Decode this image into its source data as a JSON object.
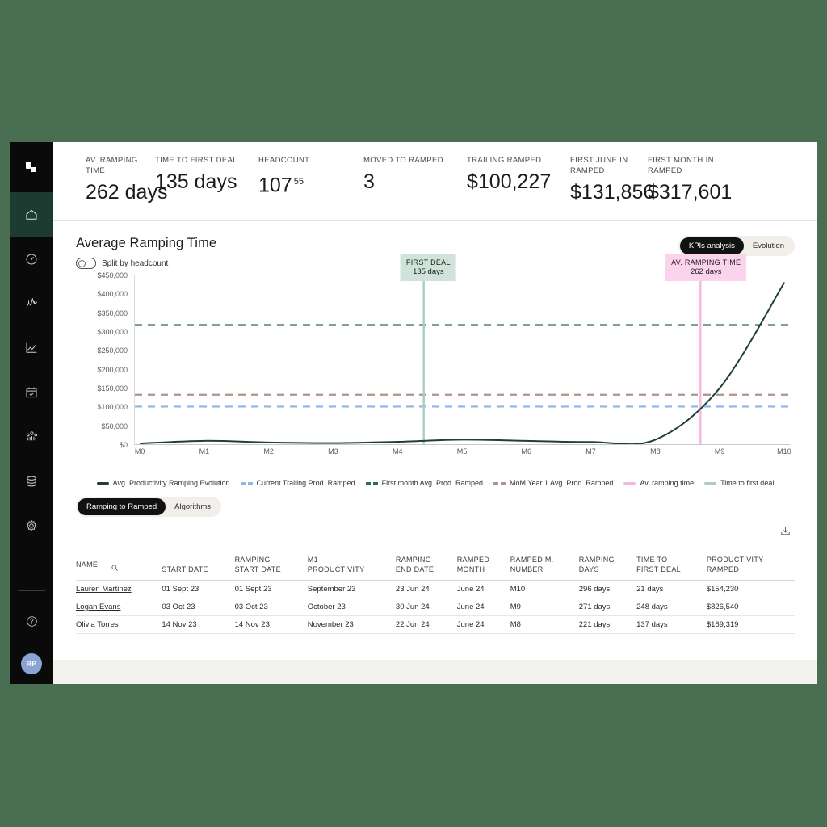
{
  "theme": {
    "page_bg": "#4a6e52",
    "sidebar_bg": "#0a0a0a",
    "active_nav_bg": "#1d3b31",
    "accent_dark": "#111111",
    "seg_track": "#f2eeea",
    "series_main": "#1f4038",
    "series_trailing": "#8ab6e8",
    "series_first_month": "#2f6b54",
    "series_mom": "#b09389",
    "series_ramping_time": "#f9b6dd",
    "series_time_first_deal": "#a8cfc0",
    "avatar_bg": "#8aa4d6"
  },
  "sidebar": {
    "logo": "brand-logo",
    "items": [
      {
        "name": "home",
        "icon": "home-icon",
        "active": true
      },
      {
        "name": "speedometer",
        "icon": "gauge-icon",
        "active": false
      },
      {
        "name": "activity",
        "icon": "pulse-bars-icon",
        "active": false
      },
      {
        "name": "analytics",
        "icon": "line-chart-icon",
        "active": false
      },
      {
        "name": "planning",
        "icon": "calendar-check-icon",
        "active": false
      },
      {
        "name": "team",
        "icon": "people-icon",
        "active": false
      },
      {
        "name": "data",
        "icon": "database-icon",
        "active": false
      },
      {
        "name": "settings",
        "icon": "gear-icon",
        "active": false
      }
    ],
    "help": {
      "name": "help",
      "icon": "question-circle-icon"
    },
    "avatar_initials": "RP"
  },
  "kpis": [
    {
      "label": "AV. RAMPING TIME",
      "value": "262 days",
      "sup": ""
    },
    {
      "label": "TIME TO FIRST DEAL",
      "value": "135 days",
      "sup": ""
    },
    {
      "label": "HEADCOUNT",
      "value": "107",
      "sup": "55"
    },
    {
      "label": "MOVED TO RAMPED",
      "value": "3",
      "sup": ""
    },
    {
      "label": "TRAILING RAMPED",
      "value": "$100,227",
      "sup": ""
    },
    {
      "label": "FIRST JUNE IN\nRAMPED",
      "value": "$131,856",
      "sup": ""
    },
    {
      "label": "FIRST MONTH IN\nRAMPED",
      "value": "$317,601",
      "sup": ""
    }
  ],
  "chart_section": {
    "title": "Average Ramping Time",
    "split_toggle_label": "Split by headcount",
    "split_toggle_on": false,
    "view_tabs": [
      {
        "label": "KPIs analysis",
        "active": true
      },
      {
        "label": "Evolution",
        "active": false
      }
    ]
  },
  "chart_data": {
    "type": "line",
    "title": "Average Ramping Time",
    "xlabel": "",
    "ylabel": "",
    "grid": false,
    "legend_position": "bottom",
    "categories": [
      "M0",
      "M1",
      "M2",
      "M3",
      "M4",
      "M5",
      "M6",
      "M7",
      "M8",
      "M9",
      "M10"
    ],
    "ylim": [
      0,
      450000
    ],
    "yticks": [
      0,
      50000,
      100000,
      150000,
      200000,
      250000,
      300000,
      350000,
      400000,
      450000
    ],
    "ytick_labels": [
      "$0",
      "$50,000",
      "$100,000",
      "$150,000",
      "$200,000",
      "$250,000",
      "$300,000",
      "$350,000",
      "$400,000",
      "$450,000"
    ],
    "series": [
      {
        "name": "Avg. Productivity Ramping Evolution",
        "type": "line",
        "color": "#1f4038",
        "style": "solid",
        "values": [
          2000,
          9000,
          4500,
          3000,
          6500,
          12000,
          9000,
          6000,
          12000,
          150000,
          430000
        ]
      },
      {
        "name": "Current Trailing Prod. Ramped",
        "type": "reference-line",
        "color": "#8ab6e8",
        "style": "dashed",
        "value": 100227
      },
      {
        "name": "First month Avg. Prod. Ramped",
        "type": "reference-line",
        "color": "#2f6b54",
        "style": "dashed",
        "value": 317601
      },
      {
        "name": "MoM Year 1 Avg. Prod. Ramped",
        "type": "reference-line",
        "color": "#b09389",
        "style": "dashed",
        "value": 131856
      },
      {
        "name": "Av. ramping time",
        "type": "vertical-marker",
        "color": "#f9b6dd",
        "style": "solid",
        "x": "M8.7"
      },
      {
        "name": "Time to first deal",
        "type": "vertical-marker",
        "color": "#a8cfc0",
        "style": "solid",
        "x": "M4.4"
      }
    ],
    "annotations": [
      {
        "id": "first-deal",
        "title": "FIRST DEAL",
        "value": "135 days",
        "color": "#cfe3da",
        "x_pct": 44.5
      },
      {
        "id": "av-ramping-time",
        "title": "AV. RAMPING TIME",
        "value": "262 days",
        "color": "#fbd3ec",
        "x_pct": 86.5
      }
    ],
    "legend": [
      {
        "label": "Avg. Productivity Ramping Evolution",
        "color": "#1f4038",
        "style": "solid"
      },
      {
        "label": "Current Trailing Prod. Ramped",
        "color": "#8ab6e8",
        "style": "dashed"
      },
      {
        "label": "First month Avg. Prod. Ramped",
        "color": "#2f6b54",
        "style": "dashed"
      },
      {
        "label": "MoM Year 1 Avg. Prod. Ramped",
        "color": "#b09389",
        "style": "dashed"
      },
      {
        "label": "Av. ramping time",
        "color": "#f9b6dd",
        "style": "solid"
      },
      {
        "label": "Time to first deal",
        "color": "#a8cfc0",
        "style": "solid"
      }
    ]
  },
  "lower_tabs": [
    {
      "label": "Ramping to Ramped",
      "active": true
    },
    {
      "label": "Algorithms",
      "active": false
    }
  ],
  "table": {
    "download_icon": "download-icon",
    "search_icon": "search-icon",
    "columns": [
      "NAME",
      "START DATE",
      "RAMPING\nSTART DATE",
      "M1\nPRODUCTIVITY",
      "RAMPING\nEND DATE",
      "RAMPED\nMONTH",
      "RAMPED M.\nNUMBER",
      "RAMPING\nDAYS",
      "TIME TO\nFIRST DEAL",
      "PRODUCTIVITY\nRAMPED"
    ],
    "rows": [
      {
        "name": "Lauren Martinez",
        "start_date": "01 Sept 23",
        "ramping_start_date": "01 Sept 23",
        "m1_productivity": "September 23",
        "ramping_end_date": "23 Jun 24",
        "ramped_month": "June 24",
        "ramped_m_number": "M10",
        "ramping_days": "296 days",
        "time_to_first_deal": "21 days",
        "productivity_ramped": "$154,230"
      },
      {
        "name": "Logan Evans",
        "start_date": "03 Oct 23",
        "ramping_start_date": "03 Oct 23",
        "m1_productivity": "October 23",
        "ramping_end_date": "30 Jun 24",
        "ramped_month": "June 24",
        "ramped_m_number": "M9",
        "ramping_days": "271 days",
        "time_to_first_deal": "248 days",
        "productivity_ramped": "$826,540"
      },
      {
        "name": "Olivia Torres",
        "start_date": "14 Nov 23",
        "ramping_start_date": "14 Nov 23",
        "m1_productivity": "November 23",
        "ramping_end_date": "22 Jun 24",
        "ramped_month": "June 24",
        "ramped_m_number": "M8",
        "ramping_days": "221 days",
        "time_to_first_deal": "137 days",
        "productivity_ramped": "$169,319"
      }
    ]
  }
}
